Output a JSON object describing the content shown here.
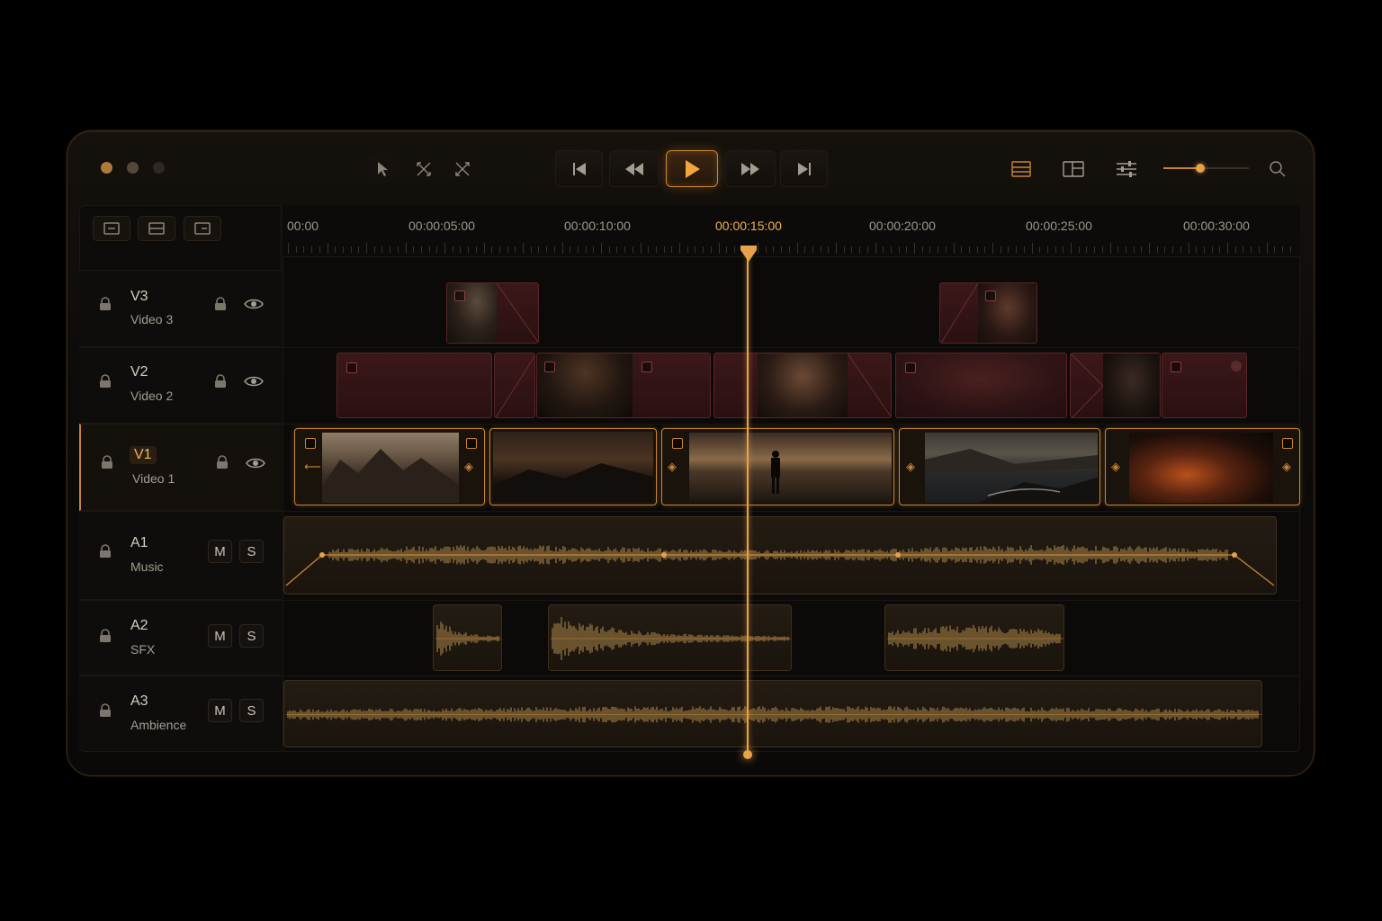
{
  "window": {
    "traffic_lights": [
      "#b07a3a",
      "#55483a",
      "#2e2822"
    ]
  },
  "toolbar": {
    "edit_tools": [
      "pointer-icon",
      "trim-icon",
      "razor-icon"
    ],
    "transport": [
      "skip-back-icon",
      "rewind-icon",
      "play-icon",
      "fast-forward-icon",
      "skip-forward-icon"
    ],
    "right_tools": [
      "timeline-view-icon",
      "layout-icon",
      "adjustments-icon",
      "search-icon"
    ],
    "zoom_level": 0.43
  },
  "view_buttons": [
    "collapse-tracks-icon",
    "expand-tracks-icon",
    "track-height-icon"
  ],
  "ruler": {
    "timecodes": [
      "00:00",
      "00:00:05:00",
      "00:00:10:00",
      "00:00:15:00",
      "00:00:20:00",
      "00:00:25:00",
      "00:00:30:00"
    ],
    "current_timecode": "00:00:15:00"
  },
  "tracks": [
    {
      "id": "V3",
      "name": "Video 3",
      "type": "video"
    },
    {
      "id": "V2",
      "name": "Video 2",
      "type": "video"
    },
    {
      "id": "V1",
      "name": "Video 1",
      "type": "video",
      "active": true
    },
    {
      "id": "A1",
      "name": "Music",
      "type": "audio"
    },
    {
      "id": "A2",
      "name": "SFX",
      "type": "audio"
    },
    {
      "id": "A3",
      "name": "Ambience",
      "type": "audio"
    }
  ],
  "audio_buttons": {
    "mute": "M",
    "solo": "S"
  },
  "colors": {
    "accent": "#c98535",
    "playhead": "#e8a24a",
    "clip_red": "#3b1819",
    "audio_wave": "#9b7a44"
  }
}
